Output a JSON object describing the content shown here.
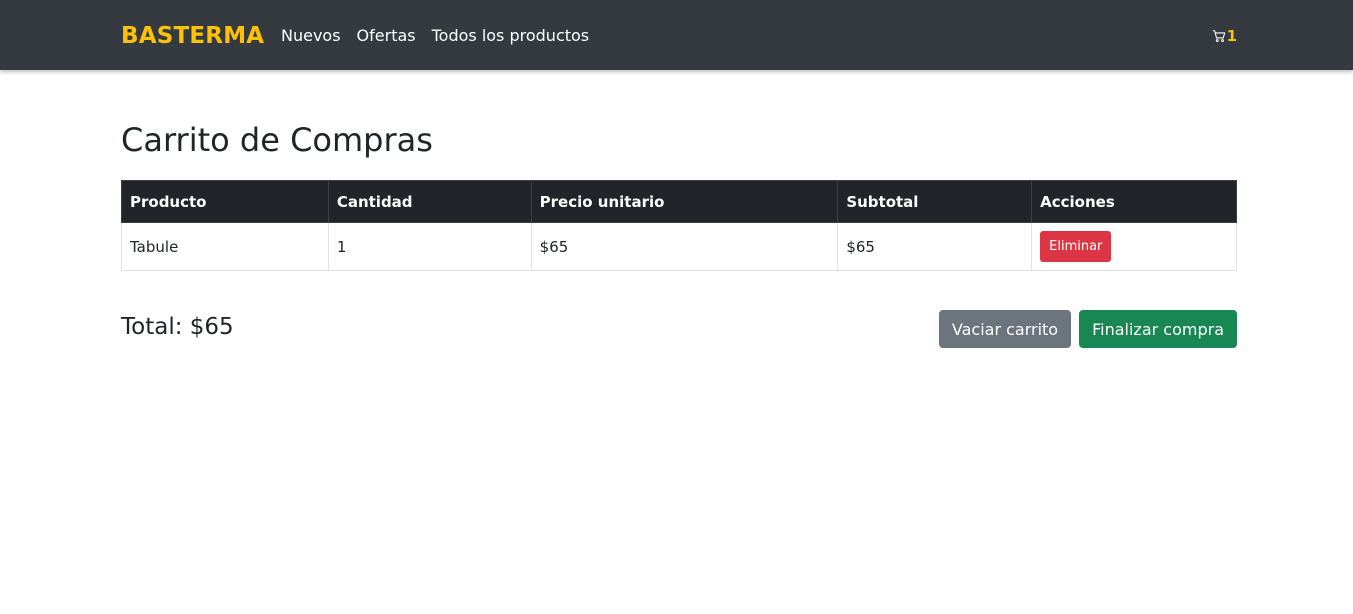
{
  "navbar": {
    "brand": "BASTERMA",
    "links": [
      {
        "label": "Nuevos"
      },
      {
        "label": "Ofertas"
      },
      {
        "label": "Todos los productos"
      }
    ],
    "cart_icon": "cart-icon",
    "cart_count": "1",
    "colors": {
      "background": "#343a40",
      "accent": "#ffc107"
    }
  },
  "page": {
    "title": "Carrito de Compras"
  },
  "table": {
    "headers": [
      "Producto",
      "Cantidad",
      "Precio unitario",
      "Subtotal",
      "Acciones"
    ],
    "rows": [
      {
        "product": "Tabule",
        "quantity": "1",
        "unit_price": "$65",
        "subtotal": "$65",
        "action_label": "Eliminar"
      }
    ]
  },
  "summary": {
    "total": "Total: $65",
    "clear_label": "Vaciar carrito",
    "checkout_label": "Finalizar compra",
    "colors": {
      "danger": "#dc3545",
      "secondary": "#6c757d",
      "success": "#198754"
    }
  }
}
